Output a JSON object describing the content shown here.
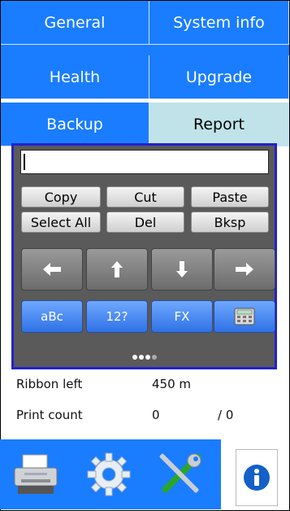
{
  "tabs": [
    {
      "label": "General",
      "active": false
    },
    {
      "label": "System info",
      "active": false
    },
    {
      "label": "Health",
      "active": false
    },
    {
      "label": "Upgrade",
      "active": false
    },
    {
      "label": "Backup",
      "active": false
    },
    {
      "label": "Report",
      "active": true
    }
  ],
  "report": {
    "ribbon_left_label": "Ribbon left",
    "ribbon_left_value": "450 m",
    "print_count_label": "Print count",
    "print_count_value": "0",
    "print_count_total": "/ 0"
  },
  "keyboard": {
    "input_value": "",
    "edit_keys": [
      "Copy",
      "Cut",
      "Paste",
      "Select All",
      "Del",
      "Bksp"
    ],
    "arrow_keys": [
      "left-arrow-icon",
      "up-arrow-icon",
      "down-arrow-icon",
      "right-arrow-icon"
    ],
    "mode_keys": [
      "aBc",
      "12?",
      "FX"
    ],
    "page_indicator": {
      "pages": 4,
      "current": 4
    }
  },
  "bottom_bar": {
    "icons": [
      "printer-icon",
      "settings-gear-icon",
      "tools-icon",
      "info-icon"
    ]
  },
  "colors": {
    "tab_blue": "#1a7dff",
    "tab_active": "#bfe3e8",
    "keyboard_border": "#2222cc",
    "mode_key_blue": "#2f72e6"
  }
}
